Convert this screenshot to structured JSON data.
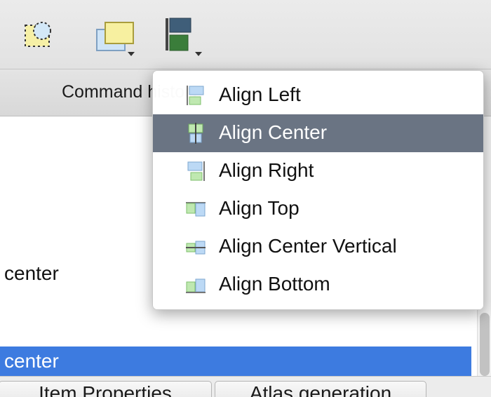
{
  "toolbar": {
    "buttons": [
      {
        "name": "select-move-item-icon"
      },
      {
        "name": "lower-raise-icon"
      },
      {
        "name": "align-items-icon"
      }
    ]
  },
  "tab_header": {
    "label": "Command history"
  },
  "panel": {
    "rows": [
      {
        "label": "l center"
      },
      {
        "label": "l center"
      }
    ]
  },
  "bottom_tabs": [
    {
      "label": "Item Properties"
    },
    {
      "label": "Atlas generation"
    }
  ],
  "menu": {
    "items": [
      {
        "label": "Align Left",
        "icon": "align-left-icon"
      },
      {
        "label": "Align Center",
        "icon": "align-center-icon",
        "highlighted": true
      },
      {
        "label": "Align Right",
        "icon": "align-right-icon"
      },
      {
        "label": "Align Top",
        "icon": "align-top-icon"
      },
      {
        "label": "Align Center Vertical",
        "icon": "align-center-vertical-icon"
      },
      {
        "label": "Align Bottom",
        "icon": "align-bottom-icon"
      }
    ]
  },
  "colors": {
    "selection": "#3d7be0",
    "menu_highlight": "#6a7483",
    "icon_blue": "#bcd9f5",
    "icon_green": "#bfe8b0"
  }
}
